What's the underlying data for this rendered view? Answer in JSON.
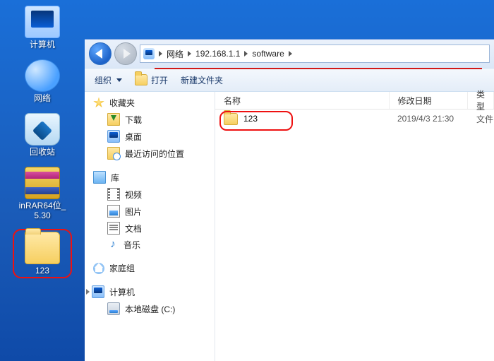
{
  "desktop": {
    "items": [
      {
        "label": "计算机",
        "icon": "computer"
      },
      {
        "label": "网络",
        "icon": "network"
      },
      {
        "label": "回收站",
        "icon": "recycle"
      },
      {
        "label": "inRAR64位_5.30",
        "icon": "winrar"
      },
      {
        "label": "123",
        "icon": "folder",
        "highlighted": true
      }
    ]
  },
  "explorer": {
    "path": {
      "segments": [
        "网络",
        "192.168.1.1",
        "software"
      ]
    },
    "toolbar": {
      "organize": "组织",
      "open": "打开",
      "newfolder": "新建文件夹"
    },
    "columns": {
      "name": "名称",
      "date": "修改日期",
      "type": "类型"
    },
    "files": [
      {
        "name": "123",
        "date": "2019/4/3 21:30",
        "type": "文件",
        "highlighted": true
      }
    ],
    "sidebar": {
      "favorites": {
        "title": "收藏夹",
        "items": [
          {
            "label": "下载",
            "icon": "dl"
          },
          {
            "label": "桌面",
            "icon": "desktop"
          },
          {
            "label": "最近访问的位置",
            "icon": "recent"
          }
        ]
      },
      "libraries": {
        "title": "库",
        "items": [
          {
            "label": "视频",
            "icon": "video"
          },
          {
            "label": "图片",
            "icon": "pic"
          },
          {
            "label": "文档",
            "icon": "doc"
          },
          {
            "label": "音乐",
            "icon": "music"
          }
        ]
      },
      "homegroup": {
        "title": "家庭组"
      },
      "computer": {
        "title": "计算机",
        "items": [
          {
            "label": "本地磁盘 (C:)",
            "icon": "disk"
          }
        ]
      }
    }
  }
}
